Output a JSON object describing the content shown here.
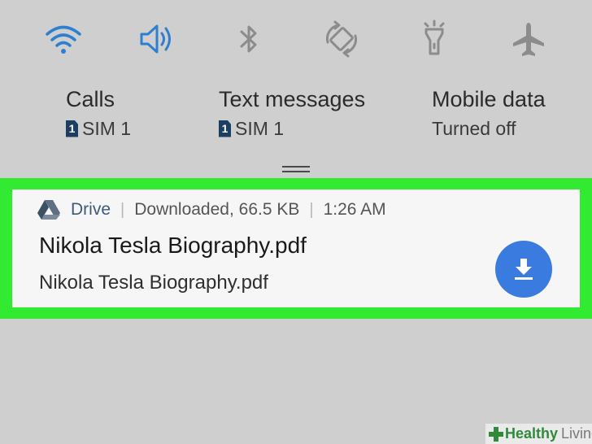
{
  "toggles": [
    {
      "name": "wifi-icon",
      "color": "#2f7fd1"
    },
    {
      "name": "sound-icon",
      "color": "#2f7fd1"
    },
    {
      "name": "bluetooth-icon",
      "color": "#8c8c8c"
    },
    {
      "name": "auto-rotate-icon",
      "color": "#8c8c8c"
    },
    {
      "name": "flashlight-icon",
      "color": "#8c8c8c"
    },
    {
      "name": "airplane-mode-icon",
      "color": "#8c8c8c"
    }
  ],
  "sim_info": {
    "calls": {
      "title": "Calls",
      "badge": "1",
      "value": "SIM 1"
    },
    "texts": {
      "title": "Text messages",
      "badge": "1",
      "value": "SIM 1"
    },
    "mobile_data": {
      "title": "Mobile data",
      "value": "Turned off"
    }
  },
  "notification": {
    "app_icon": "google-drive-icon",
    "app_name": "Drive",
    "separator": "|",
    "status": "Downloaded, 66.5 KB",
    "time": "1:26 AM",
    "title": "Nikola Tesla Biography.pdf",
    "body": "Nikola Tesla Biography.pdf",
    "action_icon": "download-icon",
    "action_color": "#3a7be0",
    "highlight_color": "#33ea33"
  },
  "watermark": {
    "part1": "Healthy",
    "part2": "Living"
  }
}
